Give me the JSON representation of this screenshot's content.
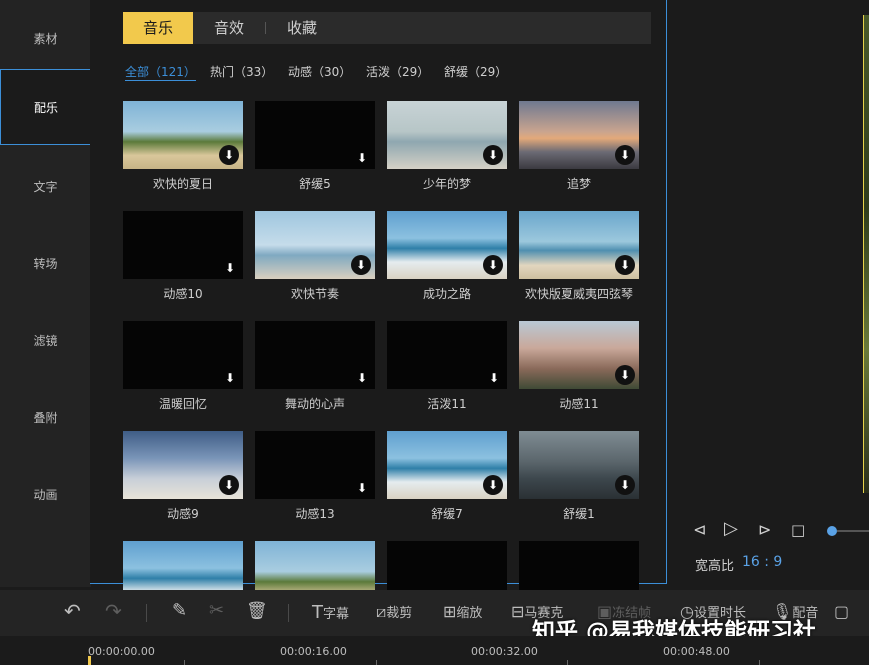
{
  "sidebar": {
    "items": [
      {
        "label": "素材"
      },
      {
        "label": "配乐"
      },
      {
        "label": "文字"
      },
      {
        "label": "转场"
      },
      {
        "label": "滤镜"
      },
      {
        "label": "叠附"
      },
      {
        "label": "动画"
      }
    ],
    "active_index": 1
  },
  "tabs": [
    {
      "label": "音乐"
    },
    {
      "label": "音效"
    },
    {
      "label": "收藏"
    }
  ],
  "filters": [
    {
      "label": "全部（121）"
    },
    {
      "label": "热门（33）"
    },
    {
      "label": "动感（30）"
    },
    {
      "label": "活泼（29）"
    },
    {
      "label": "舒缓（29）"
    }
  ],
  "tracks": [
    {
      "label": "欢快的夏日",
      "thumb": "beach-huts"
    },
    {
      "label": "舒缓5",
      "thumb": "black"
    },
    {
      "label": "少年的梦",
      "thumb": "woman-sea"
    },
    {
      "label": "追梦",
      "thumb": "sunset-beach"
    },
    {
      "label": "动感10",
      "thumb": "black"
    },
    {
      "label": "欢快节奏",
      "thumb": "girl-red"
    },
    {
      "label": "成功之路",
      "thumb": "waves"
    },
    {
      "label": "欢快版夏威夷四弦琴",
      "thumb": "beach-people"
    },
    {
      "label": "温暖回忆",
      "thumb": "black"
    },
    {
      "label": "舞动的心声",
      "thumb": "black"
    },
    {
      "label": "活泼11",
      "thumb": "black"
    },
    {
      "label": "动感11",
      "thumb": "church"
    },
    {
      "label": "动感9",
      "thumb": "airplane"
    },
    {
      "label": "动感13",
      "thumb": "black"
    },
    {
      "label": "舒缓7",
      "thumb": "waves"
    },
    {
      "label": "舒缓1",
      "thumb": "hiker"
    },
    {
      "label": "",
      "thumb": "waves"
    },
    {
      "label": "",
      "thumb": "beach-huts"
    },
    {
      "label": "",
      "thumb": "black"
    },
    {
      "label": "",
      "thumb": "black"
    }
  ],
  "download_icon": "⬇",
  "preview": {
    "aspect_label": "宽高比",
    "aspect_value": "16 : 9"
  },
  "toolbar": {
    "subtitle": "字幕",
    "crop": "裁剪",
    "zoom": "缩放",
    "mosaic": "马赛克",
    "freeze": "冻结帧",
    "duration": "设置时长",
    "dub": "配音"
  },
  "watermark": "知乎 @易我媒体技能研习社",
  "timeline": [
    "00:00:00.00",
    "00:00:16.00",
    "00:00:32.00",
    "00:00:48.00"
  ],
  "colors": {
    "accent": "#f2c94c",
    "highlight": "#3c8fd8"
  }
}
